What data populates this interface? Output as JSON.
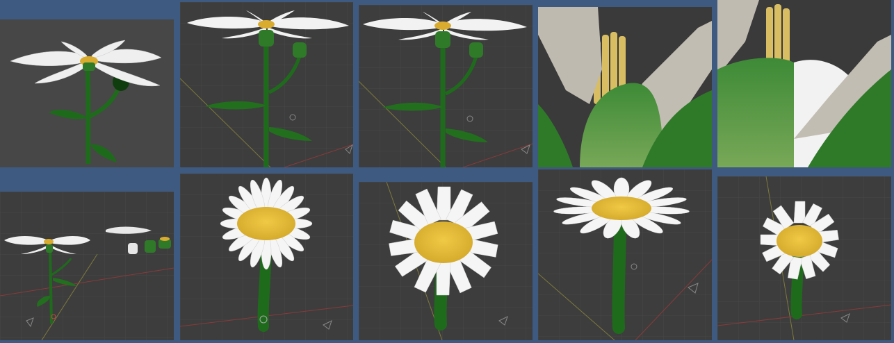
{
  "gallery": {
    "background_color": "#3e5a80",
    "viewport_color": "#3d3d3d",
    "petal_color": "#f2f2f2",
    "disc_color": "#e3b93c",
    "stem_color": "#2e7d2a",
    "tiles": [
      {
        "view": "flower-render-side"
      },
      {
        "view": "flower-viewport-front"
      },
      {
        "view": "flower-viewport-front-duplicate"
      },
      {
        "view": "flower-closeup-sepals"
      },
      {
        "view": "flower-closeup-sepals-2"
      },
      {
        "view": "scene-overview-parts"
      },
      {
        "view": "flower-top-many-petals"
      },
      {
        "view": "flower-top-front"
      },
      {
        "view": "flower-top-tilted"
      },
      {
        "view": "flower-top-small"
      }
    ]
  }
}
